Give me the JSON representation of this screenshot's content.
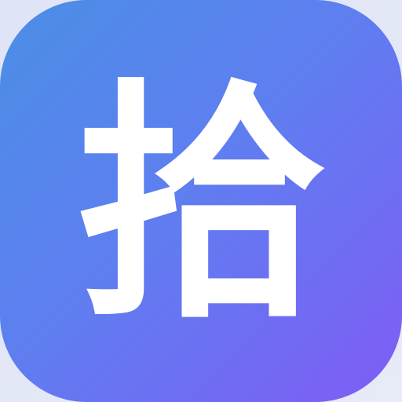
{
  "app_icon": {
    "glyph": "拾",
    "gradient_start": "#4b8ee6",
    "gradient_mid": "#5e7ff0",
    "gradient_end": "#7f5cf5",
    "glyph_color": "#ffffff"
  }
}
